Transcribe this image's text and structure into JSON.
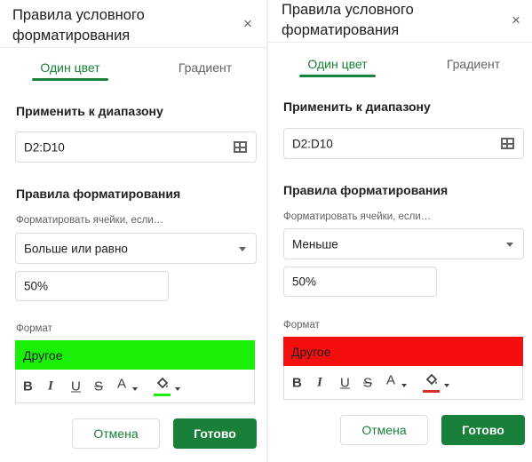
{
  "colors": {
    "accent": "#188038",
    "left_fill": "#1aef08",
    "right_fill": "#f50e0e",
    "left_fill_bar": "#1aef08",
    "right_fill_bar": "#d93025"
  },
  "icons": [
    "close-icon",
    "grid-range-icon",
    "dropdown-arrow-icon",
    "bold-icon",
    "italic-icon",
    "underline-icon",
    "strikethrough-icon",
    "text-color-icon",
    "fill-color-icon"
  ],
  "panels": [
    {
      "title": "Правила условного форматирования",
      "close": "×",
      "tabs": [
        "Один цвет",
        "Градиент"
      ],
      "range_label": "Применить к диапазону",
      "range_value": "D2:D10",
      "rules_label": "Правила форматирования",
      "condition_label": "Форматировать ячейки, если…",
      "condition_value": "Больше или равно",
      "threshold_value": "50%",
      "format_label": "Формат",
      "preview_text": "Другое",
      "toolbar": {
        "bold": "B",
        "italic": "I",
        "underline": "U",
        "strike": "S",
        "text_color": "A"
      },
      "cancel": "Отмена",
      "done": "Готово"
    },
    {
      "title": "Правила условного форматирования",
      "close": "×",
      "tabs": [
        "Один цвет",
        "Градиент"
      ],
      "range_label": "Применить к диапазону",
      "range_value": "D2:D10",
      "rules_label": "Правила форматирования",
      "condition_label": "Форматировать ячейки, если…",
      "condition_value": "Меньше",
      "threshold_value": "50%",
      "format_label": "Формат",
      "preview_text": "Другое",
      "toolbar": {
        "bold": "B",
        "italic": "I",
        "underline": "U",
        "strike": "S",
        "text_color": "A"
      },
      "cancel": "Отмена",
      "done": "Готово"
    }
  ]
}
